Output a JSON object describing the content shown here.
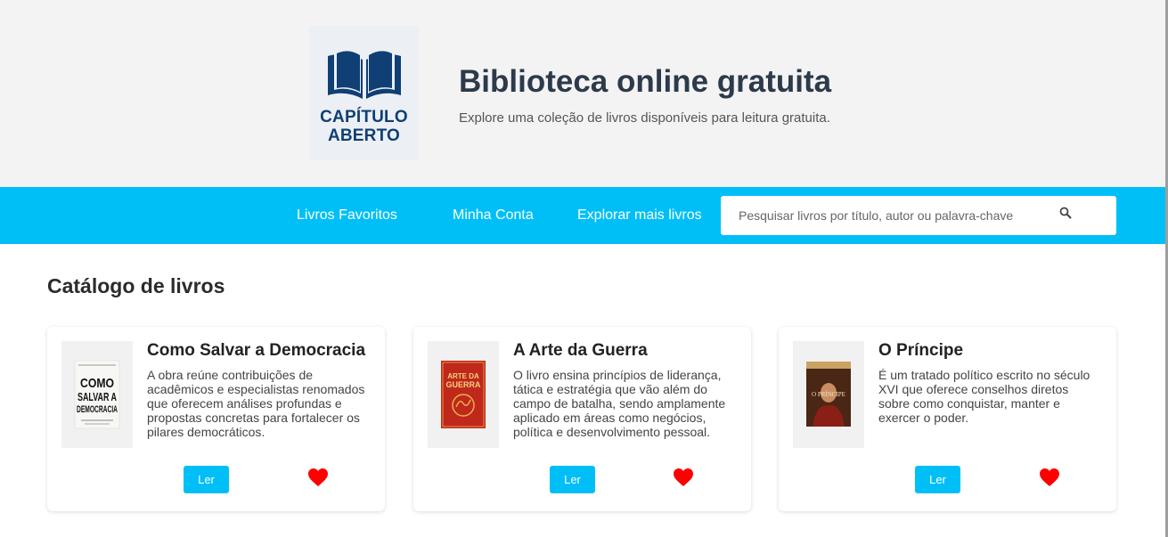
{
  "header": {
    "logo": {
      "line1": "CAPÍTULO",
      "line2": "ABERTO",
      "color": "#0f3f74"
    },
    "title": "Biblioteca online gratuita",
    "subtitle": "Explore uma coleção de livros disponíveis para leitura gratuita."
  },
  "nav": {
    "links": [
      "Livros Favoritos",
      "Minha Conta",
      "Explorar mais livros"
    ],
    "search_placeholder": "Pesquisar livros por título, autor ou palavra-chave",
    "search_icon": "search-icon",
    "accent": "#00bff7"
  },
  "catalog": {
    "title": "Catálogo de livros",
    "books": [
      {
        "title": "Como Salvar a Democracia",
        "description": "A obra reúne contribuições de acadêmicos e especialistas renomados que oferecem análises profundas e propostas concretas para fortalecer os pilares democráticos.",
        "cover_lines": [
          "COMO",
          "SALVAR A",
          "DEMOCRACIA"
        ],
        "read_label": "Ler"
      },
      {
        "title": "A Arte da Guerra",
        "description": "O livro ensina princípios de liderança, tática e estratégia que vão além do campo de batalha, sendo amplamente aplicado em áreas como negócios, política e desenvolvimento pessoal.",
        "cover_lines": [
          "ARTE DA",
          "GUERRA"
        ],
        "read_label": "Ler"
      },
      {
        "title": "O Príncipe",
        "description": "É um tratado político escrito no século XVI que oferece conselhos diretos sobre como conquistar, manter e exercer o poder.",
        "cover_lines": [
          "O PRÍNCIPE"
        ],
        "read_label": "Ler"
      }
    ],
    "heart_color": "#ff0000"
  }
}
